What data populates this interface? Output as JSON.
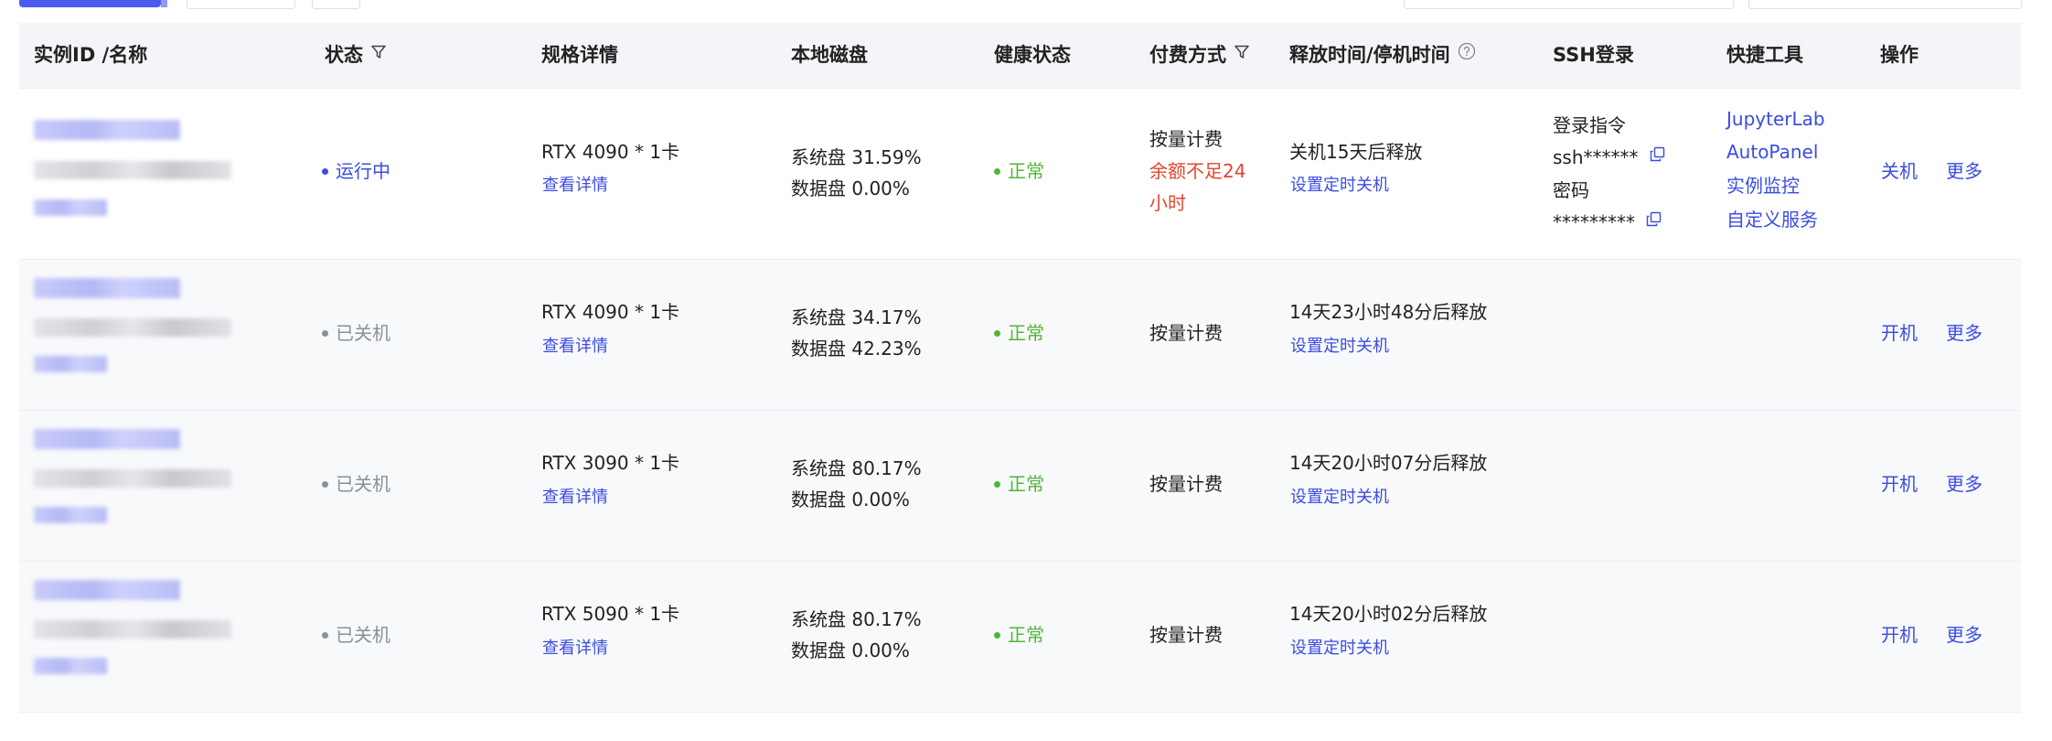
{
  "table": {
    "headers": {
      "instance": "实例ID /名称",
      "status": "状态",
      "spec": "规格详情",
      "disk": "本地磁盘",
      "health": "健康状态",
      "billing": "付费方式",
      "release": "释放时间/停机时间",
      "ssh": "SSH登录",
      "tools": "快捷工具",
      "actions": "操作"
    },
    "rows": [
      {
        "status": "运行中",
        "spec": "RTX 4090 * 1卡",
        "spec_link": "查看详情",
        "sys_disk": "系统盘 31.59%",
        "data_disk": "数据盘 0.00%",
        "health": "正常",
        "billing": "按量计费",
        "billing_warn_1": "余额不足24",
        "billing_warn_2": "小时",
        "release": "关机15天后释放",
        "schedule_link": "设置定时关机",
        "ssh_cmd_label": "登录指令",
        "ssh_cmd_value": "ssh******",
        "ssh_pwd_label": "密码",
        "ssh_pwd_value": "*********",
        "tools": [
          "JupyterLab",
          "AutoPanel",
          "实例监控",
          "自定义服务"
        ],
        "action_primary": "关机",
        "action_more": "更多"
      },
      {
        "status": "已关机",
        "spec": "RTX 4090 * 1卡",
        "spec_link": "查看详情",
        "sys_disk": "系统盘 34.17%",
        "data_disk": "数据盘 42.23%",
        "health": "正常",
        "billing": "按量计费",
        "release": "14天23小时48分后释放",
        "schedule_link": "设置定时关机",
        "action_primary": "开机",
        "action_more": "更多"
      },
      {
        "status": "已关机",
        "spec": "RTX 3090 * 1卡",
        "spec_link": "查看详情",
        "sys_disk": "系统盘 80.17%",
        "data_disk": "数据盘 0.00%",
        "health": "正常",
        "billing": "按量计费",
        "release": "14天20小时07分后释放",
        "schedule_link": "设置定时关机",
        "action_primary": "开机",
        "action_more": "更多"
      },
      {
        "status": "已关机",
        "spec": "RTX 5090 * 1卡",
        "spec_link": "查看详情",
        "sys_disk": "系统盘 80.17%",
        "data_disk": "数据盘 0.00%",
        "health": "正常",
        "billing": "按量计费",
        "release": "14天20小时02分后释放",
        "schedule_link": "设置定时关机",
        "action_primary": "开机",
        "action_more": "更多"
      }
    ]
  },
  "colors": {
    "accent": "#3a4ce3",
    "primary_button": "#4a5cf0",
    "health_ok": "#52b535",
    "warning": "#e5452e",
    "status_off": "#8a8f99",
    "header_bg": "#f4f5f8",
    "row_alt_bg": "#f8f9fb"
  },
  "icons": {
    "filter": "filter-icon",
    "help": "help-icon",
    "copy": "copy-icon"
  }
}
